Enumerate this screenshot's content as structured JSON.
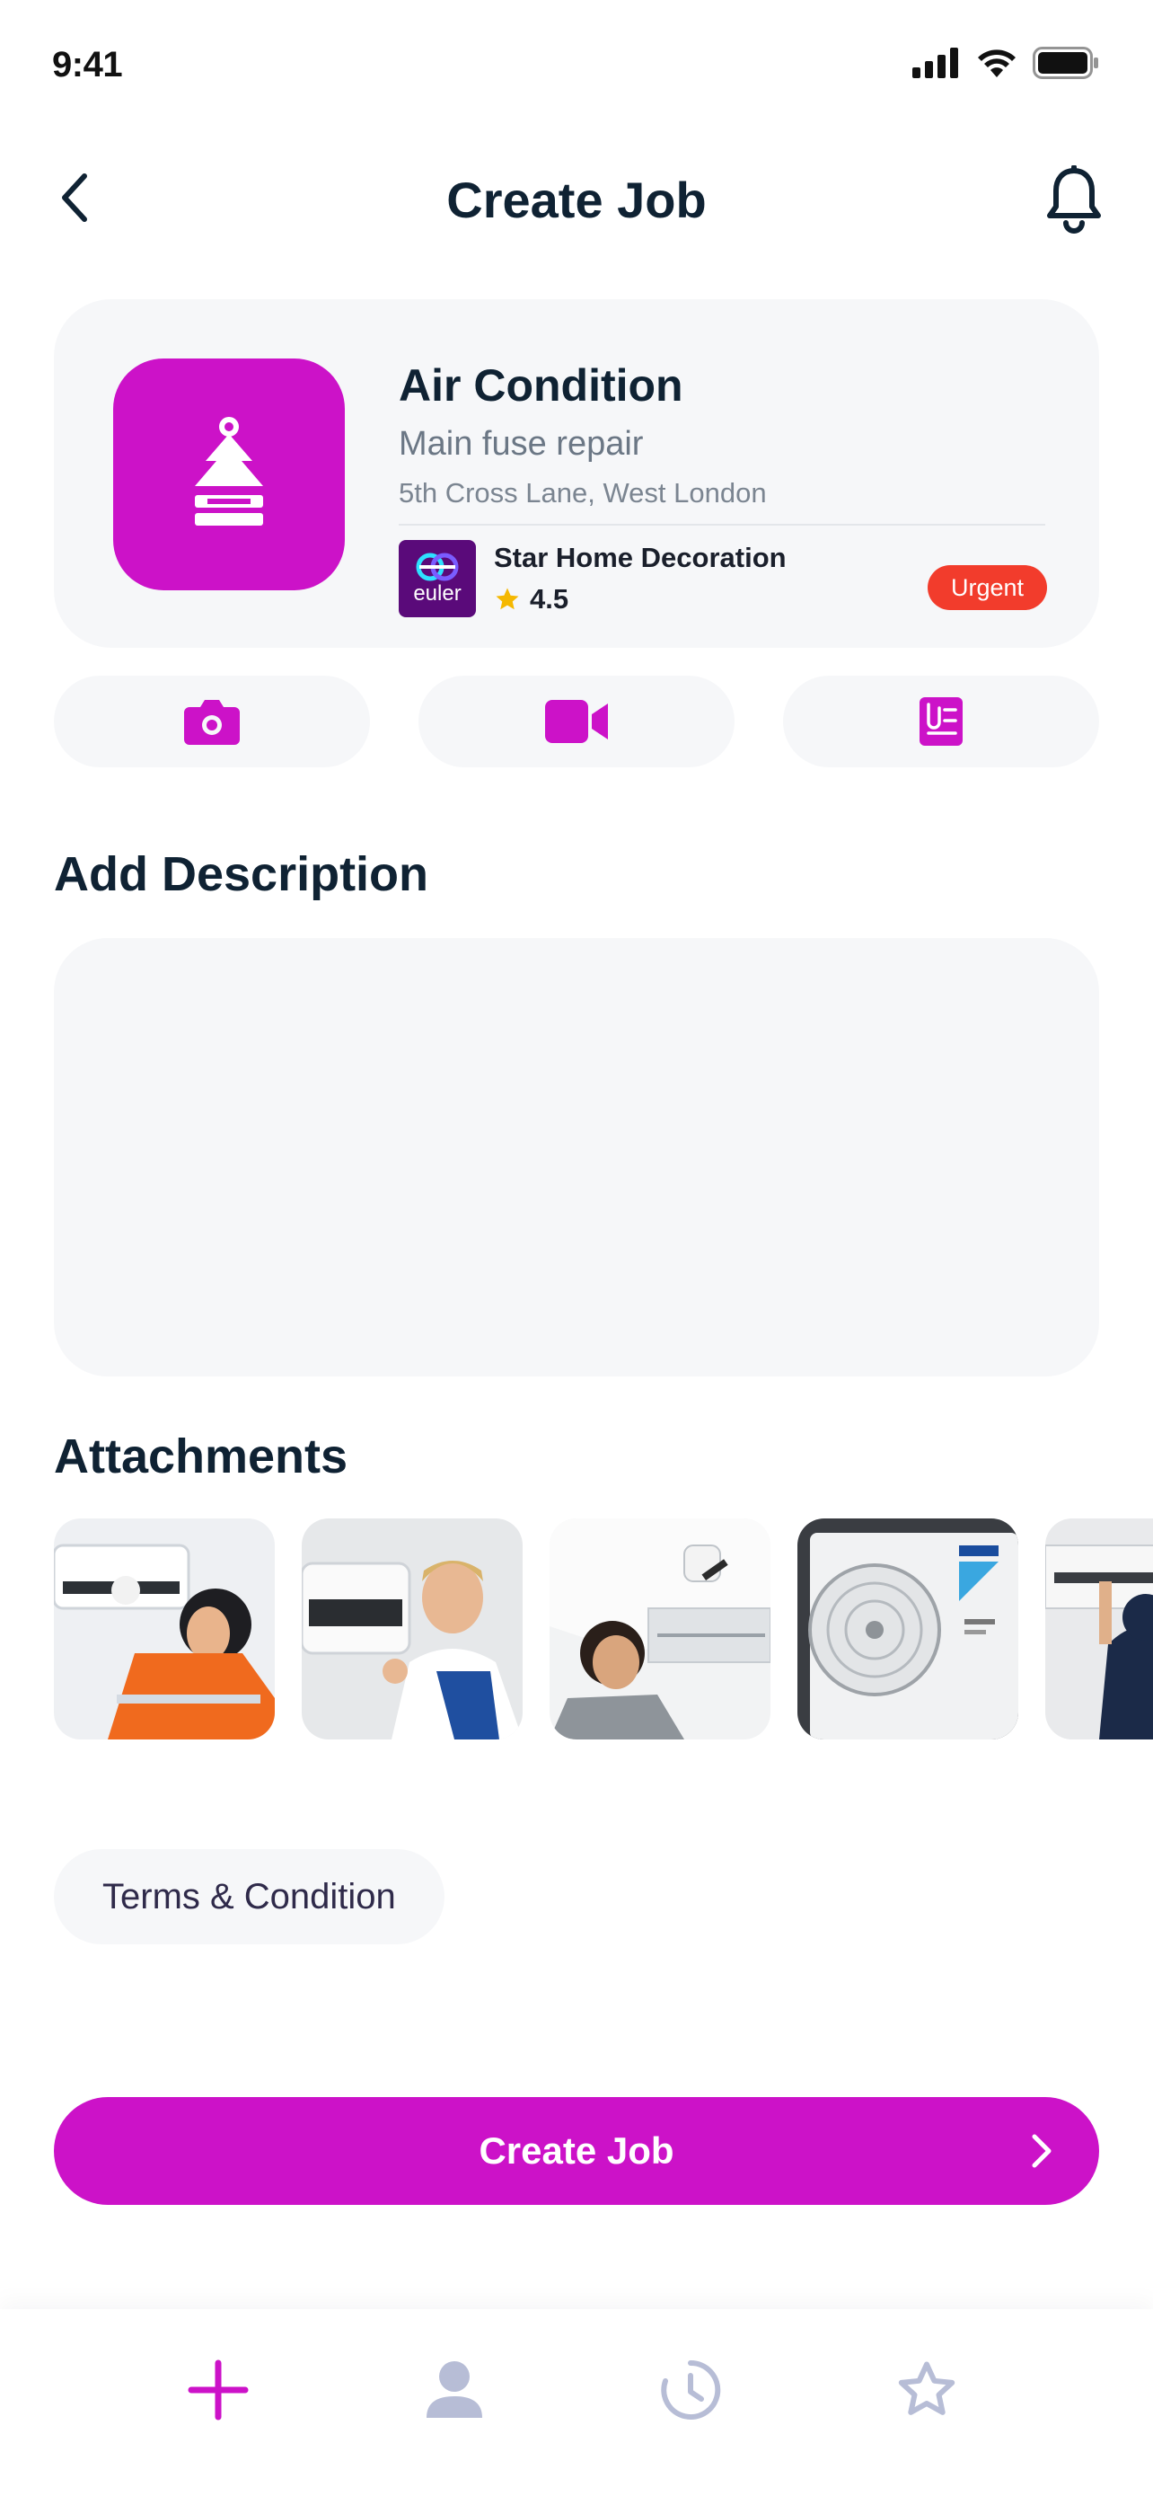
{
  "status_bar": {
    "time": "9:41"
  },
  "header": {
    "title": "Create Job"
  },
  "job": {
    "category": "Air Condition",
    "subtitle": "Main fuse repair",
    "address": "5th Cross Lane, West London",
    "provider": {
      "name": "Star Home Decoration",
      "logo_text": "euler",
      "rating": "4.5"
    },
    "badge": "Urgent"
  },
  "media_buttons": [
    {
      "icon": "camera-icon"
    },
    {
      "icon": "video-icon"
    },
    {
      "icon": "document-attach-icon"
    }
  ],
  "description": {
    "title": "Add Description",
    "value": ""
  },
  "attachments": {
    "title": "Attachments",
    "items": [
      "photo-1",
      "photo-2",
      "photo-3",
      "photo-4",
      "photo-5"
    ]
  },
  "terms": {
    "label": "Terms & Condition"
  },
  "primary_action": {
    "label": "Create Job"
  },
  "bottom_nav": {
    "items": [
      {
        "icon": "plus-icon",
        "active": true
      },
      {
        "icon": "user-icon",
        "active": false
      },
      {
        "icon": "history-icon",
        "active": false
      },
      {
        "icon": "star-icon",
        "active": false
      }
    ]
  },
  "colors": {
    "accent": "#cc12c8",
    "text": "#0f2233",
    "muted": "#6b7785",
    "card": "#f6f7f9",
    "urgent": "#f23c2c",
    "star": "#f5b800",
    "nav_inactive": "#b7bdd6"
  }
}
